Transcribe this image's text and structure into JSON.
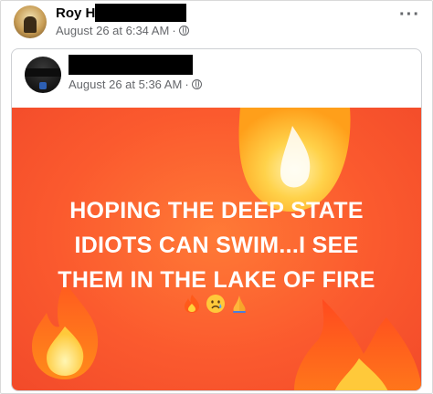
{
  "post": {
    "author_name": "Roy H",
    "timestamp": "August 26 at 6:34 AM",
    "separator": "·",
    "more_label": "···",
    "audience_icon": "globe-icon"
  },
  "shared_post": {
    "timestamp": "August 26 at 5:36 AM",
    "separator": "·",
    "audience_icon": "globe-icon",
    "image": {
      "headline_lines": [
        "HOPING THE DEEP STATE",
        "IDIOTS CAN SWIM...I SEE",
        "THEM IN THE LAKE OF FIRE"
      ],
      "emojis": [
        "fire-emoji",
        "crying-face-emoji",
        "folded-hands-emoji"
      ],
      "background_color": "#fb5a2e",
      "text_color": "#ffffff"
    }
  },
  "colors": {
    "meta_text": "#65676b",
    "redaction": "#000000"
  }
}
